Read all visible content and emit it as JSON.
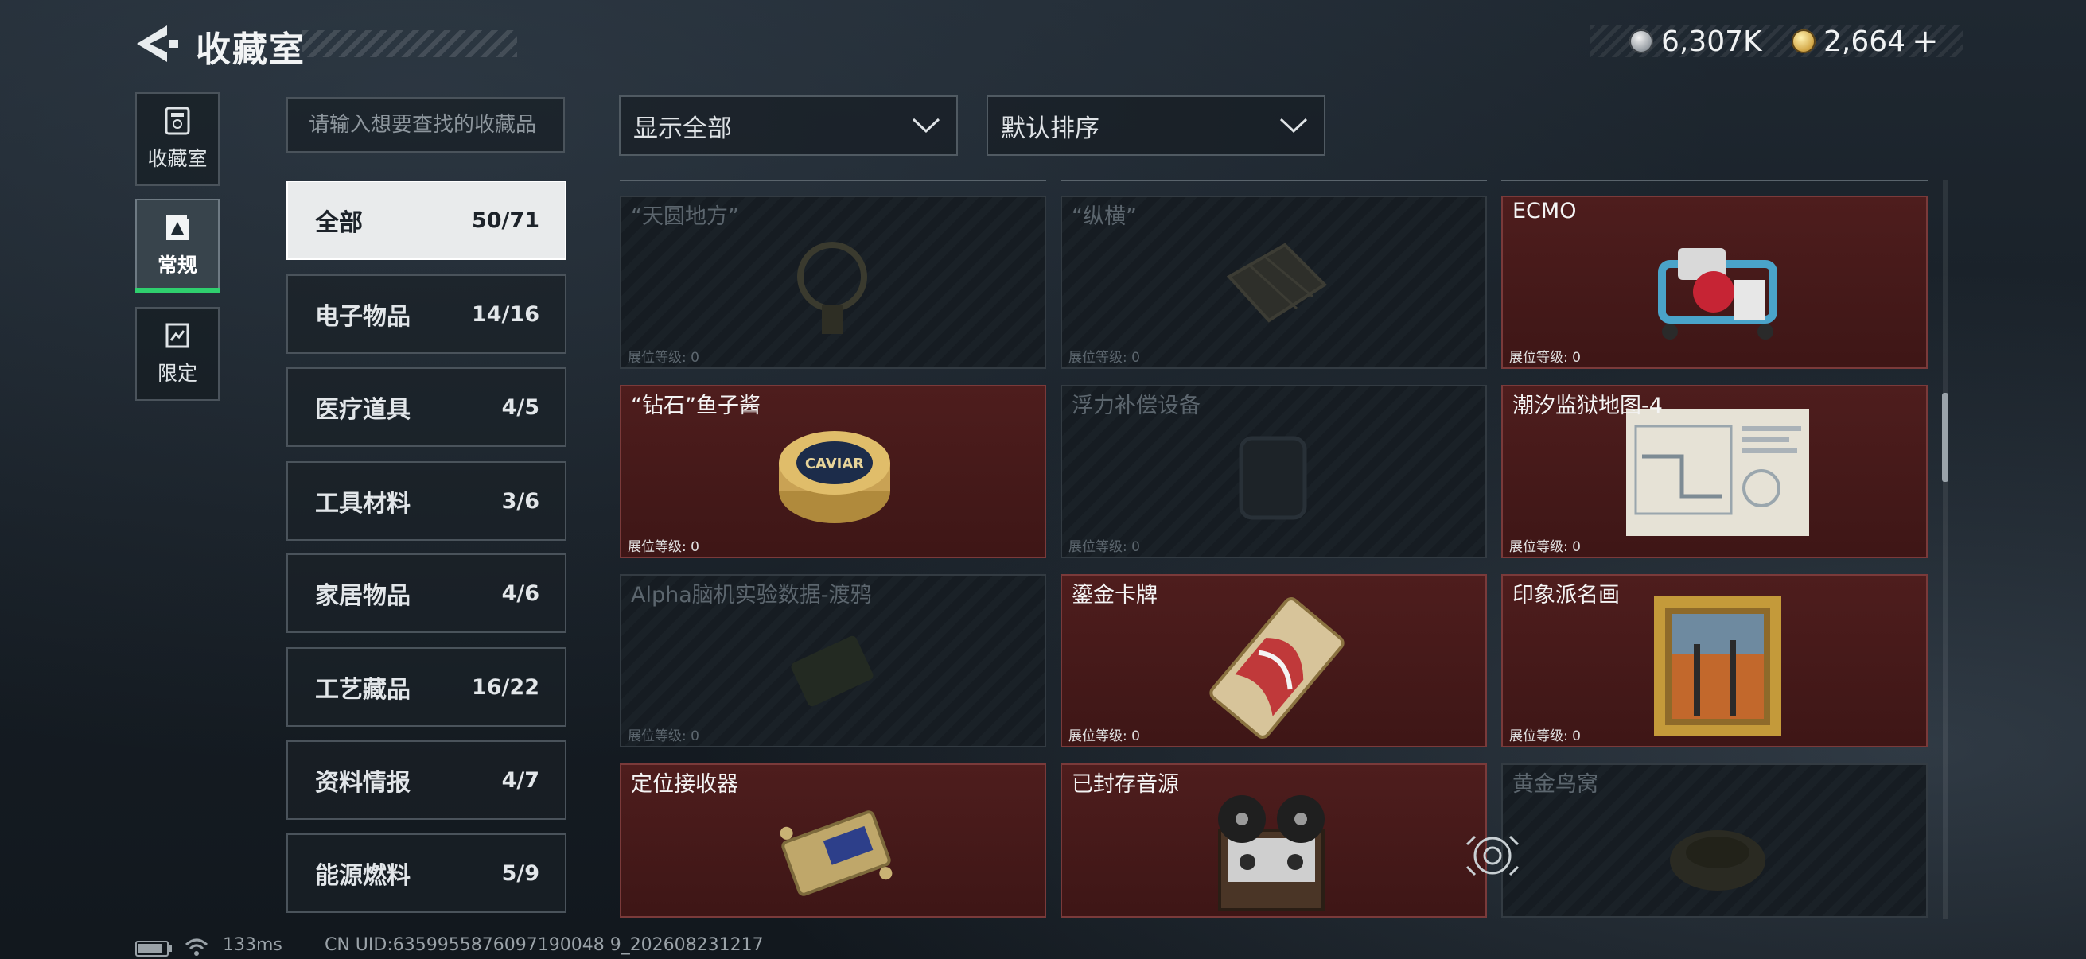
{
  "header": {
    "title": "收藏室"
  },
  "currency": {
    "silver": {
      "icon": "silver-coin-icon",
      "value": "6,307K"
    },
    "gold": {
      "icon": "gold-coin-icon",
      "value": "2,664"
    },
    "plus_label": "+"
  },
  "side_nav": [
    {
      "label": "收藏室",
      "icon": "vault-icon",
      "active": false
    },
    {
      "label": "常规",
      "icon": "gallery-icon",
      "active": true
    },
    {
      "label": "限定",
      "icon": "limited-icon",
      "active": false
    }
  ],
  "search": {
    "placeholder": "请输入想要查找的收藏品"
  },
  "categories": [
    {
      "label": "全部",
      "count": "50/71",
      "active": true
    },
    {
      "label": "电子物品",
      "count": "14/16"
    },
    {
      "label": "医疗道具",
      "count": "4/5"
    },
    {
      "label": "工具材料",
      "count": "3/6"
    },
    {
      "label": "家居物品",
      "count": "4/6"
    },
    {
      "label": "工艺藏品",
      "count": "16/22"
    },
    {
      "label": "资料情报",
      "count": "4/7"
    },
    {
      "label": "能源燃料",
      "count": "5/9"
    }
  ],
  "filters": {
    "display": "显示全部",
    "sort": "默认排序"
  },
  "level_label": "展位等级:",
  "items": [
    {
      "name": "“天圆地方”",
      "level": "0",
      "owned": false,
      "icon": "compass-icon"
    },
    {
      "name": "“纵横”",
      "level": "0",
      "owned": false,
      "icon": "chessboard-icon"
    },
    {
      "name": "ECMO",
      "level": "0",
      "owned": true,
      "icon": "ecmo-machine-icon"
    },
    {
      "name": "“钻石”鱼子酱",
      "level": "0",
      "owned": true,
      "icon": "caviar-tin-icon",
      "art_text": "CAVIAR"
    },
    {
      "name": "浮力补偿设备",
      "level": "0",
      "owned": false,
      "icon": "buoyancy-device-icon"
    },
    {
      "name": "潮汐监狱地图-4",
      "level": "0",
      "owned": true,
      "icon": "map-icon"
    },
    {
      "name": "Alpha脑机实验数据-渡鸦",
      "level": "0",
      "owned": false,
      "icon": "data-drive-icon"
    },
    {
      "name": "鎏金卡牌",
      "level": "0",
      "owned": true,
      "icon": "gilded-card-icon"
    },
    {
      "name": "印象派名画",
      "level": "0",
      "owned": true,
      "icon": "painting-icon"
    },
    {
      "name": "定位接收器",
      "level": "",
      "owned": true,
      "icon": "receiver-icon"
    },
    {
      "name": "已封存音源",
      "level": "",
      "owned": true,
      "icon": "reel-recorder-icon"
    },
    {
      "name": "黄金鸟窝",
      "level": "",
      "owned": false,
      "icon": "gold-nest-icon"
    }
  ],
  "status_bar": {
    "ping": "133ms",
    "uid": "CN UID:6359955876097190048 9_202608231217"
  }
}
